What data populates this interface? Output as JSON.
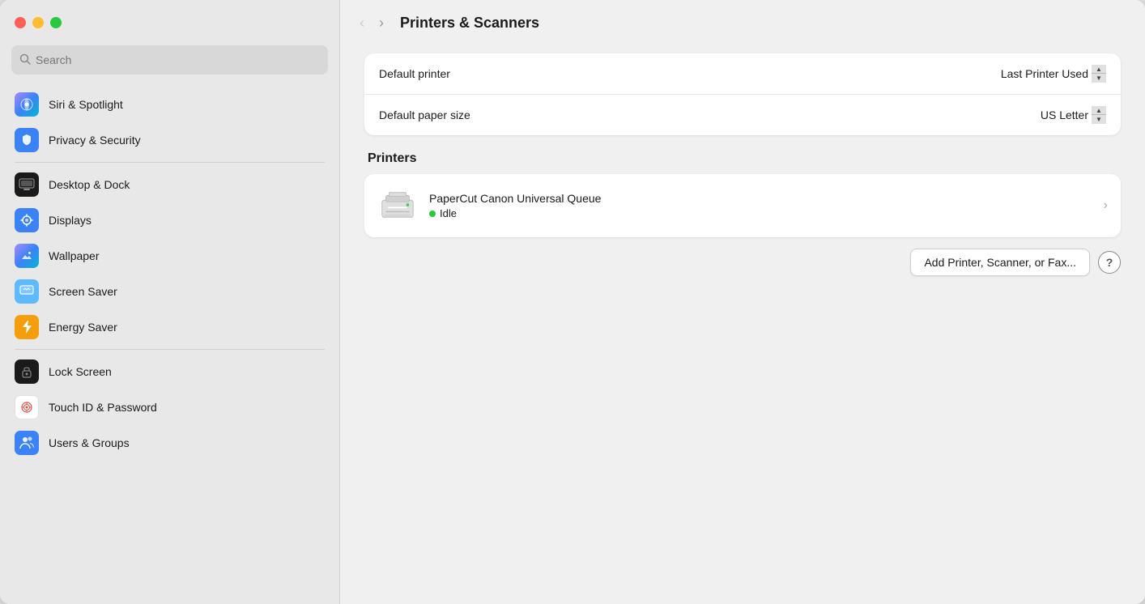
{
  "window": {
    "title": "Printers & Scanners"
  },
  "traffic_lights": {
    "close": "close",
    "minimize": "minimize",
    "maximize": "maximize"
  },
  "search": {
    "placeholder": "Search"
  },
  "sidebar": {
    "items": [
      {
        "id": "siri-spotlight",
        "label": "Siri & Spotlight",
        "icon_type": "siri"
      },
      {
        "id": "privacy-security",
        "label": "Privacy & Security",
        "icon_type": "privacy"
      },
      {
        "id": "desktop-dock",
        "label": "Desktop & Dock",
        "icon_type": "desktop"
      },
      {
        "id": "displays",
        "label": "Displays",
        "icon_type": "displays"
      },
      {
        "id": "wallpaper",
        "label": "Wallpaper",
        "icon_type": "wallpaper"
      },
      {
        "id": "screen-saver",
        "label": "Screen Saver",
        "icon_type": "screensaver"
      },
      {
        "id": "energy-saver",
        "label": "Energy Saver",
        "icon_type": "energy"
      },
      {
        "id": "lock-screen",
        "label": "Lock Screen",
        "icon_type": "lockscreen"
      },
      {
        "id": "touch-id",
        "label": "Touch ID & Password",
        "icon_type": "touchid"
      },
      {
        "id": "users-groups",
        "label": "Users & Groups",
        "icon_type": "users"
      }
    ]
  },
  "nav": {
    "back_disabled": true,
    "forward_disabled": false
  },
  "main": {
    "title": "Printers & Scanners",
    "settings": [
      {
        "id": "default-printer",
        "label": "Default printer",
        "value": "Last Printer Used"
      },
      {
        "id": "default-paper-size",
        "label": "Default paper size",
        "value": "US Letter"
      }
    ],
    "printers_section_title": "Printers",
    "printers": [
      {
        "id": "papercut-canon",
        "name": "PaperCut Canon Universal Queue",
        "status": "Idle",
        "status_color": "#28c840"
      }
    ],
    "add_button_label": "Add Printer, Scanner, or Fax...",
    "help_label": "?"
  }
}
